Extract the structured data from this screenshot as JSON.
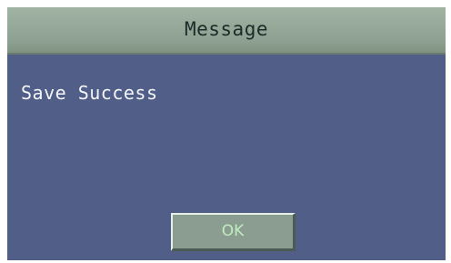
{
  "dialog": {
    "title": "Message",
    "message": "Save Success",
    "ok_label": "OK"
  },
  "colors": {
    "dialog_background": "#505e88",
    "titlebar_background": "#8ea091",
    "button_background": "#8a9d90",
    "button_text": "#c2ecbf"
  }
}
